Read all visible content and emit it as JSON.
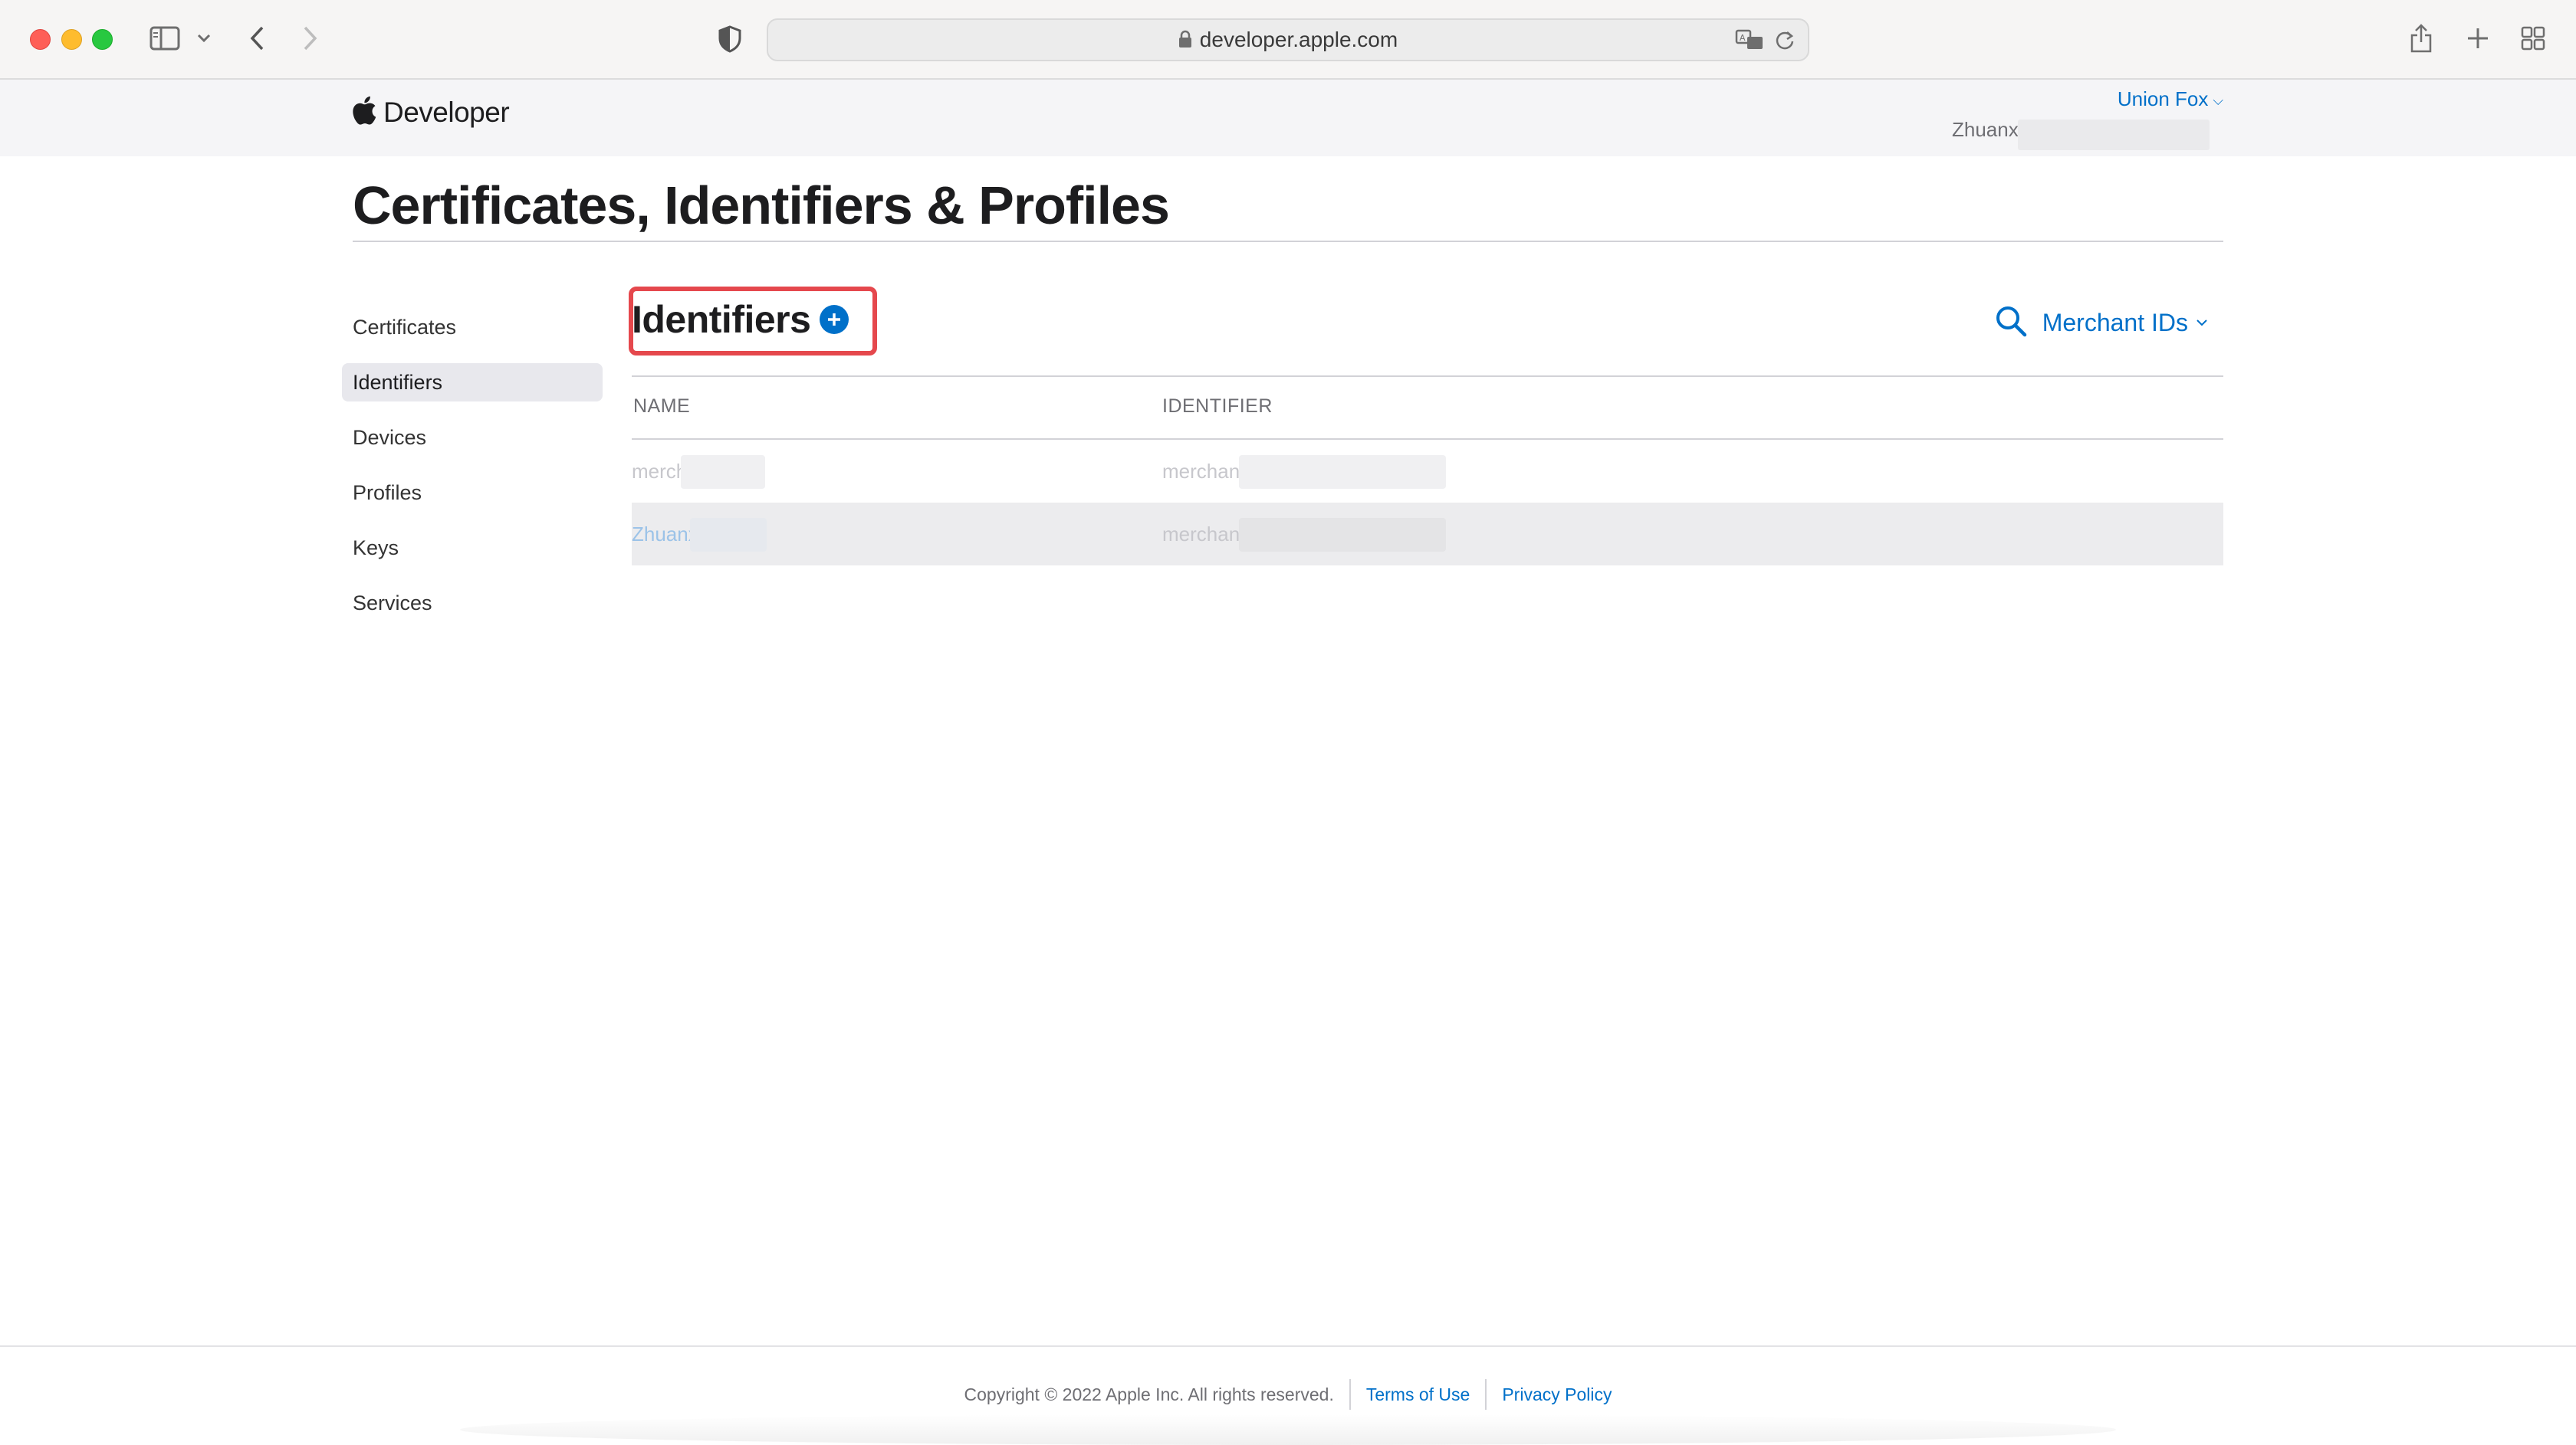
{
  "browser": {
    "url": "developer.apple.com",
    "icons": {
      "sidebar": "sidebar-toggle-icon",
      "back": "chevron-left-icon",
      "forward": "chevron-right-icon",
      "shield": "privacy-shield-icon",
      "lock": "lock-icon",
      "translate": "translate-icon",
      "reload": "reload-icon",
      "share": "share-icon",
      "new_tab": "plus-icon",
      "tab_overview": "tab-grid-icon"
    }
  },
  "header": {
    "brand": "Developer",
    "team": "Union Fox",
    "account": "Zhuanx"
  },
  "page": {
    "title": "Certificates, Identifiers & Profiles"
  },
  "sidebar": {
    "items": [
      {
        "label": "Certificates",
        "active": false
      },
      {
        "label": "Identifiers",
        "active": true
      },
      {
        "label": "Devices",
        "active": false
      },
      {
        "label": "Profiles",
        "active": false
      },
      {
        "label": "Keys",
        "active": false
      },
      {
        "label": "Services",
        "active": false
      }
    ]
  },
  "main": {
    "section_title": "Identifiers",
    "filter_label": "Merchant IDs",
    "columns": [
      "NAME",
      "IDENTIFIER"
    ],
    "rows": [
      {
        "name": "merch",
        "identifier": "merchant"
      },
      {
        "name": "Zhuanx",
        "identifier": "merchant"
      }
    ]
  },
  "footer": {
    "copyright": "Copyright © 2022 Apple Inc. All rights reserved.",
    "terms": "Terms of Use",
    "privacy": "Privacy Policy"
  },
  "colors": {
    "accent": "#0070c9",
    "highlight": "#e5484d"
  }
}
